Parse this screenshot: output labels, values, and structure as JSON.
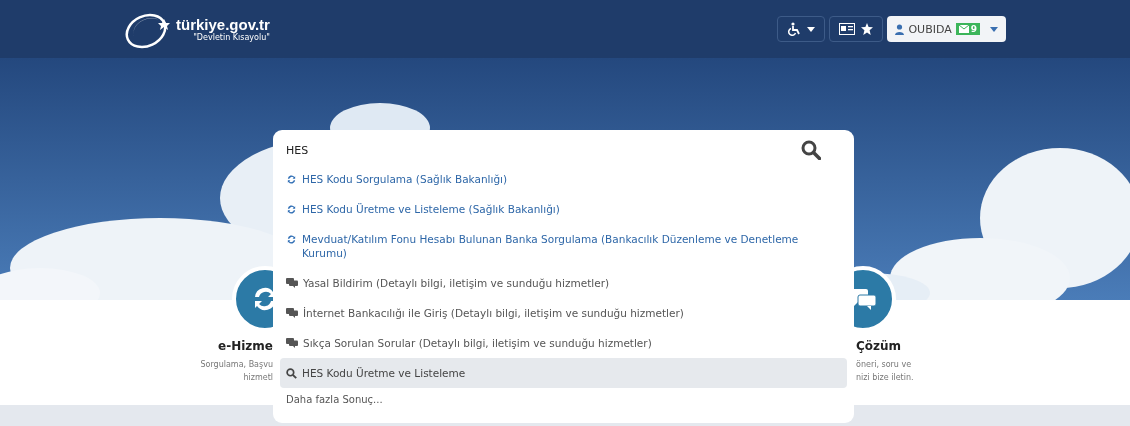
{
  "header": {
    "logo": "türkiye.gov.tr",
    "logo_tagline": "\"Devletin Kısayolu\"",
    "user_name": "OUBIDA",
    "message_count": "9"
  },
  "search": {
    "value": "HES"
  },
  "suggestions": [
    {
      "kind": "service",
      "text": "HES Kodu Sorgulama (Sağlık Bakanlığı)",
      "selected": false
    },
    {
      "kind": "service",
      "text": "HES Kodu Üretme ve Listeleme (Sağlık Bakanlığı)",
      "selected": false
    },
    {
      "kind": "service",
      "text": "Mevduat/Katılım Fonu Hesabı Bulunan Banka Sorgulama (Bankacılık Düzenleme ve Denetleme Kurumu)",
      "selected": false
    },
    {
      "kind": "info",
      "text": "Yasal Bildirim (Detaylı bilgi, iletişim ve sunduğu hizmetler)",
      "selected": false
    },
    {
      "kind": "info",
      "text": "İnternet Bankacılığı ile Giriş (Detaylı bilgi, iletişim ve sunduğu hizmetler)",
      "selected": false
    },
    {
      "kind": "info",
      "text": "Sıkça Sorulan Sorular (Detaylı bilgi, iletişim ve sunduğu hizmetler)",
      "selected": false
    },
    {
      "kind": "search",
      "text": "HES Kodu Üretme ve Listeleme",
      "selected": true
    }
  ],
  "more_results": "Daha fazla Sonuç...",
  "cards": [
    {
      "title": "e-Hizme",
      "lines": [
        "Sorgulama, Başvu",
        "hizmetl"
      ]
    },
    {
      "title": "Çözüm",
      "lines": [
        "öneri, soru ve",
        "nizi bize iletin."
      ]
    }
  ]
}
